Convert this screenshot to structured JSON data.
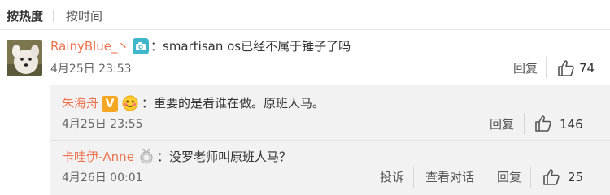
{
  "sort": {
    "hot": "按热度",
    "time": "按时间"
  },
  "comment": {
    "username": "RainyBlue_",
    "username_suffix": "丶",
    "badge_icon": "camera-badge-icon",
    "text": "：smartisan os已经不属于锤子了吗",
    "time": "4月25日 23:53",
    "reply_label": "回复",
    "like_count": "74"
  },
  "replies": [
    {
      "username": "朱海舟",
      "badges": [
        "verified-v-badge-icon",
        "emoji-face-icon"
      ],
      "text": "：重要的是看谁在做。原班人马。",
      "time": "4月25日 23:55",
      "reply_label": "回复",
      "like_count": "146"
    },
    {
      "username": "卡哇伊-Anne",
      "badges": [
        "medal-badge-icon"
      ],
      "text": "：没罗老师叫原班人马？",
      "time": "4月26日 00:01",
      "report_label": "投诉",
      "view_dialog_label": "查看对话",
      "reply_label": "回复",
      "like_count": "25"
    }
  ],
  "colors": {
    "username": "#eb7350",
    "reply_bg": "#f2f2f2",
    "verified_badge": "#f5a623",
    "camera_badge": "#3fb6c9"
  }
}
